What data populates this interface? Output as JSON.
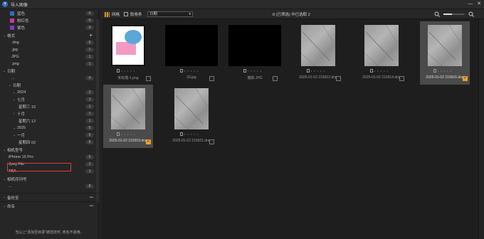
{
  "window": {
    "title": "导入图像",
    "min": "—",
    "close": "✕"
  },
  "sidebar": {
    "colors": [
      {
        "label": "蓝色",
        "count": "0",
        "color": "#2d6cc8"
      },
      {
        "label": "粉红色",
        "count": "0",
        "color": "#c83a96"
      },
      {
        "label": "紫色",
        "count": "0",
        "color": "#7a3ac8"
      }
    ],
    "format_header": "格式",
    "format_add": "+",
    "formats": [
      {
        "label": ".dng",
        "count": "5"
      },
      {
        "label": ".jpg",
        "count": "1"
      },
      {
        "label": "JPG",
        "count": "1"
      },
      {
        "label": ".png",
        "count": "1"
      }
    ],
    "date_header": "日期",
    "dates": [
      {
        "label": "...",
        "count": "0"
      },
      {
        "label": "日期",
        "count": "",
        "chev": "v"
      },
      {
        "label": "2024",
        "count": "2",
        "chev": "v"
      },
      {
        "label": "七月",
        "count": "1",
        "chev": "v"
      },
      {
        "label": "星期三 10",
        "count": "1"
      },
      {
        "label": "十月",
        "count": "1",
        "chev": ">"
      },
      {
        "label": "星期六 12",
        "count": "1"
      },
      {
        "label": "2025",
        "count": "5",
        "chev": "v"
      },
      {
        "label": "一月",
        "count": "5",
        "chev": "v"
      },
      {
        "label": "星期四 02",
        "count": "5"
      }
    ],
    "camera_header": "相机型号",
    "cameras": [
      {
        "label": "iPhone 16 Pro",
        "count": "5"
      },
      {
        "label": "Jpeg File",
        "count": "2"
      },
      {
        "label": "TBA",
        "count": "1"
      }
    ],
    "serial_header": "相机序列号",
    "serials": [
      {
        "label": "...",
        "count": "8"
      }
    ],
    "backup_label": "备份至",
    "backup_more": "•••",
    "naming_label": "命名",
    "naming_more": "•••",
    "note": "当以上\"添加至目录\"被选定时, 命名不适用。"
  },
  "toolbar": {
    "tab1": "网格",
    "tab2": "胶卷条",
    "sort": "日期",
    "sort_arrow": "▾",
    "status": "8 (已筛选) 中已选取 2"
  },
  "thumbnails": [
    {
      "name": "未标题-1.png",
      "checked": false,
      "type": "drawing",
      "selected": false
    },
    {
      "name": "33.jpg",
      "checked": false,
      "type": "black",
      "selected": false
    },
    {
      "name": "捕获.JPG",
      "checked": false,
      "type": "black",
      "selected": false
    },
    {
      "name": "2025-01-02 215912.dng",
      "checked": false,
      "type": "stone",
      "selected": false
    },
    {
      "name": "2025-01-02 215914.dng",
      "checked": false,
      "type": "stone",
      "selected": false
    },
    {
      "name": "2025-01-02 215916.dng",
      "checked": true,
      "type": "stone",
      "selected": true
    },
    {
      "name": "2025-01-02 215919.dng",
      "checked": true,
      "type": "stone",
      "selected": true
    },
    {
      "name": "2025-01-02 215921.dng",
      "checked": false,
      "type": "stone",
      "selected": false
    }
  ],
  "thumb_dots": "• • • • •",
  "check_mark": "✓"
}
